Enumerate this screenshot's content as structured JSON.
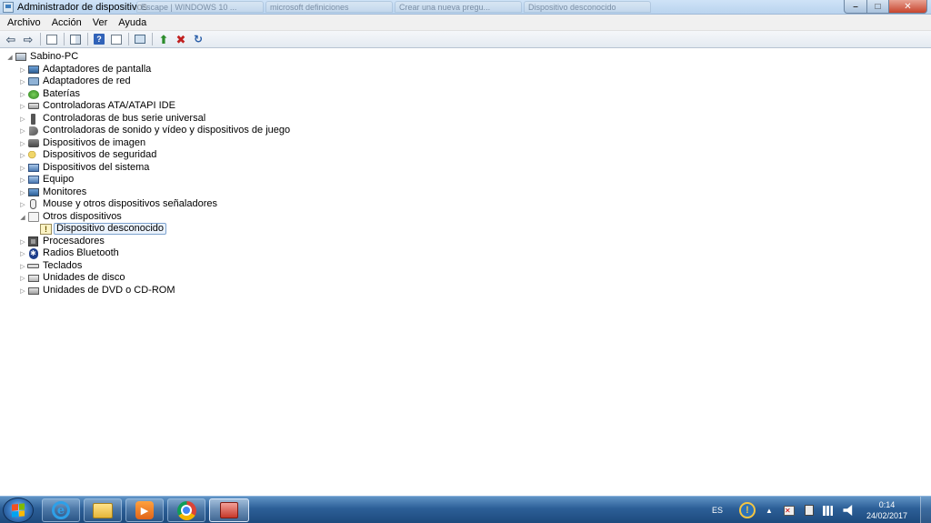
{
  "window": {
    "title": "Administrador de dispositivos",
    "background_tabs": [
      "Escape | WINDOWS 10 ...",
      "microsoft definiciones",
      "Crear una nueva pregu...",
      "Dispositivo desconocido"
    ]
  },
  "menu": {
    "items": [
      "Archivo",
      "Acción",
      "Ver",
      "Ayuda"
    ]
  },
  "toolbar": {
    "buttons": [
      "back-arrow-icon",
      "forward-arrow-icon",
      "console-tree-icon",
      "properties-icon",
      "help-icon",
      "view-icon",
      "scan-hardware-icon",
      "update-driver-icon",
      "uninstall-icon",
      "enable-icon"
    ]
  },
  "tree": {
    "root": "Sabino-PC",
    "categories": [
      {
        "label": "Adaptadores de pantalla",
        "icon": "monitor-icon"
      },
      {
        "label": "Adaptadores de red",
        "icon": "network-adapter-icon"
      },
      {
        "label": "Baterías",
        "icon": "battery-icon"
      },
      {
        "label": "Controladoras ATA/ATAPI IDE",
        "icon": "ide-controller-icon"
      },
      {
        "label": "Controladoras de bus serie universal",
        "icon": "usb-icon"
      },
      {
        "label": "Controladoras de sonido y vídeo y dispositivos de juego",
        "icon": "sound-icon"
      },
      {
        "label": "Dispositivos de imagen",
        "icon": "camera-icon"
      },
      {
        "label": "Dispositivos de seguridad",
        "icon": "security-key-icon"
      },
      {
        "label": "Dispositivos del sistema",
        "icon": "system-icon"
      },
      {
        "label": "Equipo",
        "icon": "computer-icon"
      },
      {
        "label": "Monitores",
        "icon": "monitor-icon"
      },
      {
        "label": "Mouse y otros dispositivos señaladores",
        "icon": "mouse-icon"
      },
      {
        "label": "Otros dispositivos",
        "icon": "other-devices-icon"
      },
      {
        "label": "Dispositivo desconocido",
        "icon": "unknown-device-warning-icon"
      },
      {
        "label": "Procesadores",
        "icon": "processor-icon"
      },
      {
        "label": "Radios Bluetooth",
        "icon": "bluetooth-icon"
      },
      {
        "label": "Teclados",
        "icon": "keyboard-icon"
      },
      {
        "label": "Unidades de disco",
        "icon": "disk-drive-icon"
      },
      {
        "label": "Unidades de DVD o CD-ROM",
        "icon": "dvd-drive-icon"
      }
    ]
  },
  "taskbar": {
    "pinned": [
      "internet-explorer-icon",
      "file-explorer-icon",
      "media-player-icon",
      "chrome-icon",
      "device-manager-icon"
    ],
    "language": "ES",
    "time": "0:14",
    "date": "24/02/2017"
  }
}
